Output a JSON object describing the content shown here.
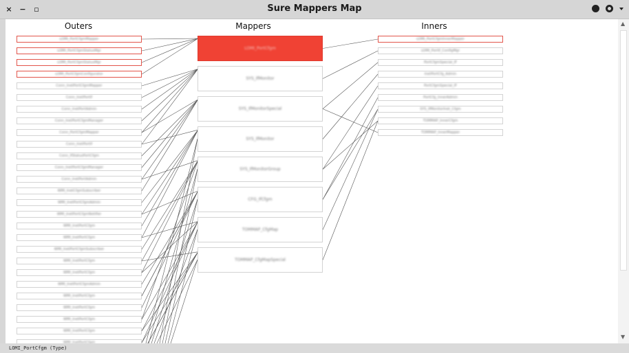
{
  "window": {
    "title": "Sure Mappers Map"
  },
  "titlebar": {
    "close_glyph": "×",
    "minimize_glyph": "−",
    "maximize_glyph": "▫"
  },
  "columns": {
    "outers": "Outers",
    "mappers": "Mappers",
    "inners": "Inners"
  },
  "outers": [
    "LOMI_PortCfgmMapper",
    "LOMI_PortCfgmStatusMgr",
    "LOMI_PortCfgmStatusMgr",
    "LOMI_PortCfgmConfigurator",
    "Conn_InetPortCfgmMapper",
    "Conn_InetPortIf",
    "Conn_InetPortAdmin",
    "Conn_InetPortCfgmManager",
    "Conn_PortCfgmMapper",
    "Conn_InetPortIf",
    "Conn_IfStatusPortCfgm",
    "Conn_InetPortCfgmManager",
    "Conn_InetPortAdmin",
    "WMI_InetCfgmSubscriber",
    "WMI_InetPortCfgmAdmin",
    "WMI_InetPortCfgmNotifier",
    "WMI_InetPortCfgm",
    "WMI_InetPortCfgm",
    "WMI_InetPortCfgmSubscriber",
    "WMI_InetPortCfgm",
    "WMI_InetPortCfgm",
    "WMI_InetPortCfgmAdmin",
    "WMI_InetPortCfgm",
    "WMI_InetPortCfgm",
    "WMI_InetPortCfgm",
    "WMI_InetPortCfgm",
    "WMI_InetPortCfgm",
    "WMI_InetPortCfgmSubscriber"
  ],
  "selected_outers": [
    0,
    1,
    2,
    3
  ],
  "mappers": [
    "LOMI_PortCfgm",
    "SYS_IfMonitor",
    "SYS_IfMonitorSpecial",
    "SYS_IfMonitor",
    "SYS_IfMonitorGroup",
    "CFG_IfCfgm",
    "TOMMAP_CfgMap",
    "TOMMAP_CfgMapSpecial"
  ],
  "active_mapper": 0,
  "inners": [
    "LOMI_PortCfgmInnerMapper",
    "LOMI_PortIf_ConfigMgr",
    "PortCfgmSpecial_IF",
    "InetPortCfg_Admin",
    "PortCfgmSpecial_IF",
    "PortCfg_InnerAdmin",
    "SYS_IfMonitorInet_Cfgm",
    "TOMMAP_InnerCfgm",
    "TOMMAP_InnerMapper"
  ],
  "selected_inners": [
    0
  ],
  "status": {
    "text": "LOMI_PortCfgm (Type)"
  },
  "colors": {
    "active": "#f04234",
    "selected_border": "#e2544a",
    "line": "#555555"
  },
  "icons": {
    "menu_a": "circle-icon",
    "menu_b": "ring-icon",
    "dropdown": "chevron-down-icon"
  }
}
